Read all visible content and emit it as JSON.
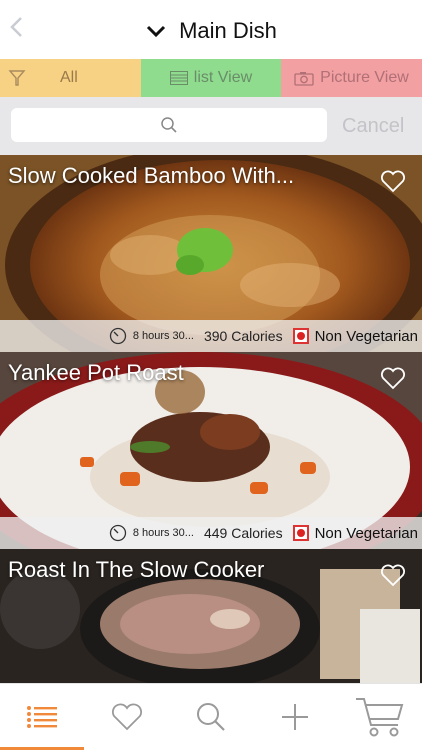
{
  "header": {
    "back_icon": "chevron-left-icon",
    "title": "Main Dish",
    "title_icon": "chevron-down-icon"
  },
  "filters": {
    "all_label": "All",
    "list_view_label": "list View",
    "picture_view_label": "Picture View",
    "colors": {
      "all": "#f7d284",
      "list": "#8fdc8f",
      "picture": "#f3a0a3"
    }
  },
  "search": {
    "placeholder": "",
    "cancel_label": "Cancel"
  },
  "recipes": [
    {
      "title": "Slow Cooked Bamboo With...",
      "time": "8 hours 30...",
      "calories": "390 Calories",
      "diet": "Non Vegetarian"
    },
    {
      "title": "Yankee Pot Roast",
      "time": "8 hours 30...",
      "calories": "449 Calories",
      "diet": "Non Vegetarian"
    },
    {
      "title": "Roast In The Slow Cooker"
    }
  ],
  "tabbar": {
    "items": [
      "list-icon",
      "heart-icon",
      "search-icon",
      "plus-icon",
      "cart-icon"
    ],
    "accent": "#f08a3a"
  }
}
